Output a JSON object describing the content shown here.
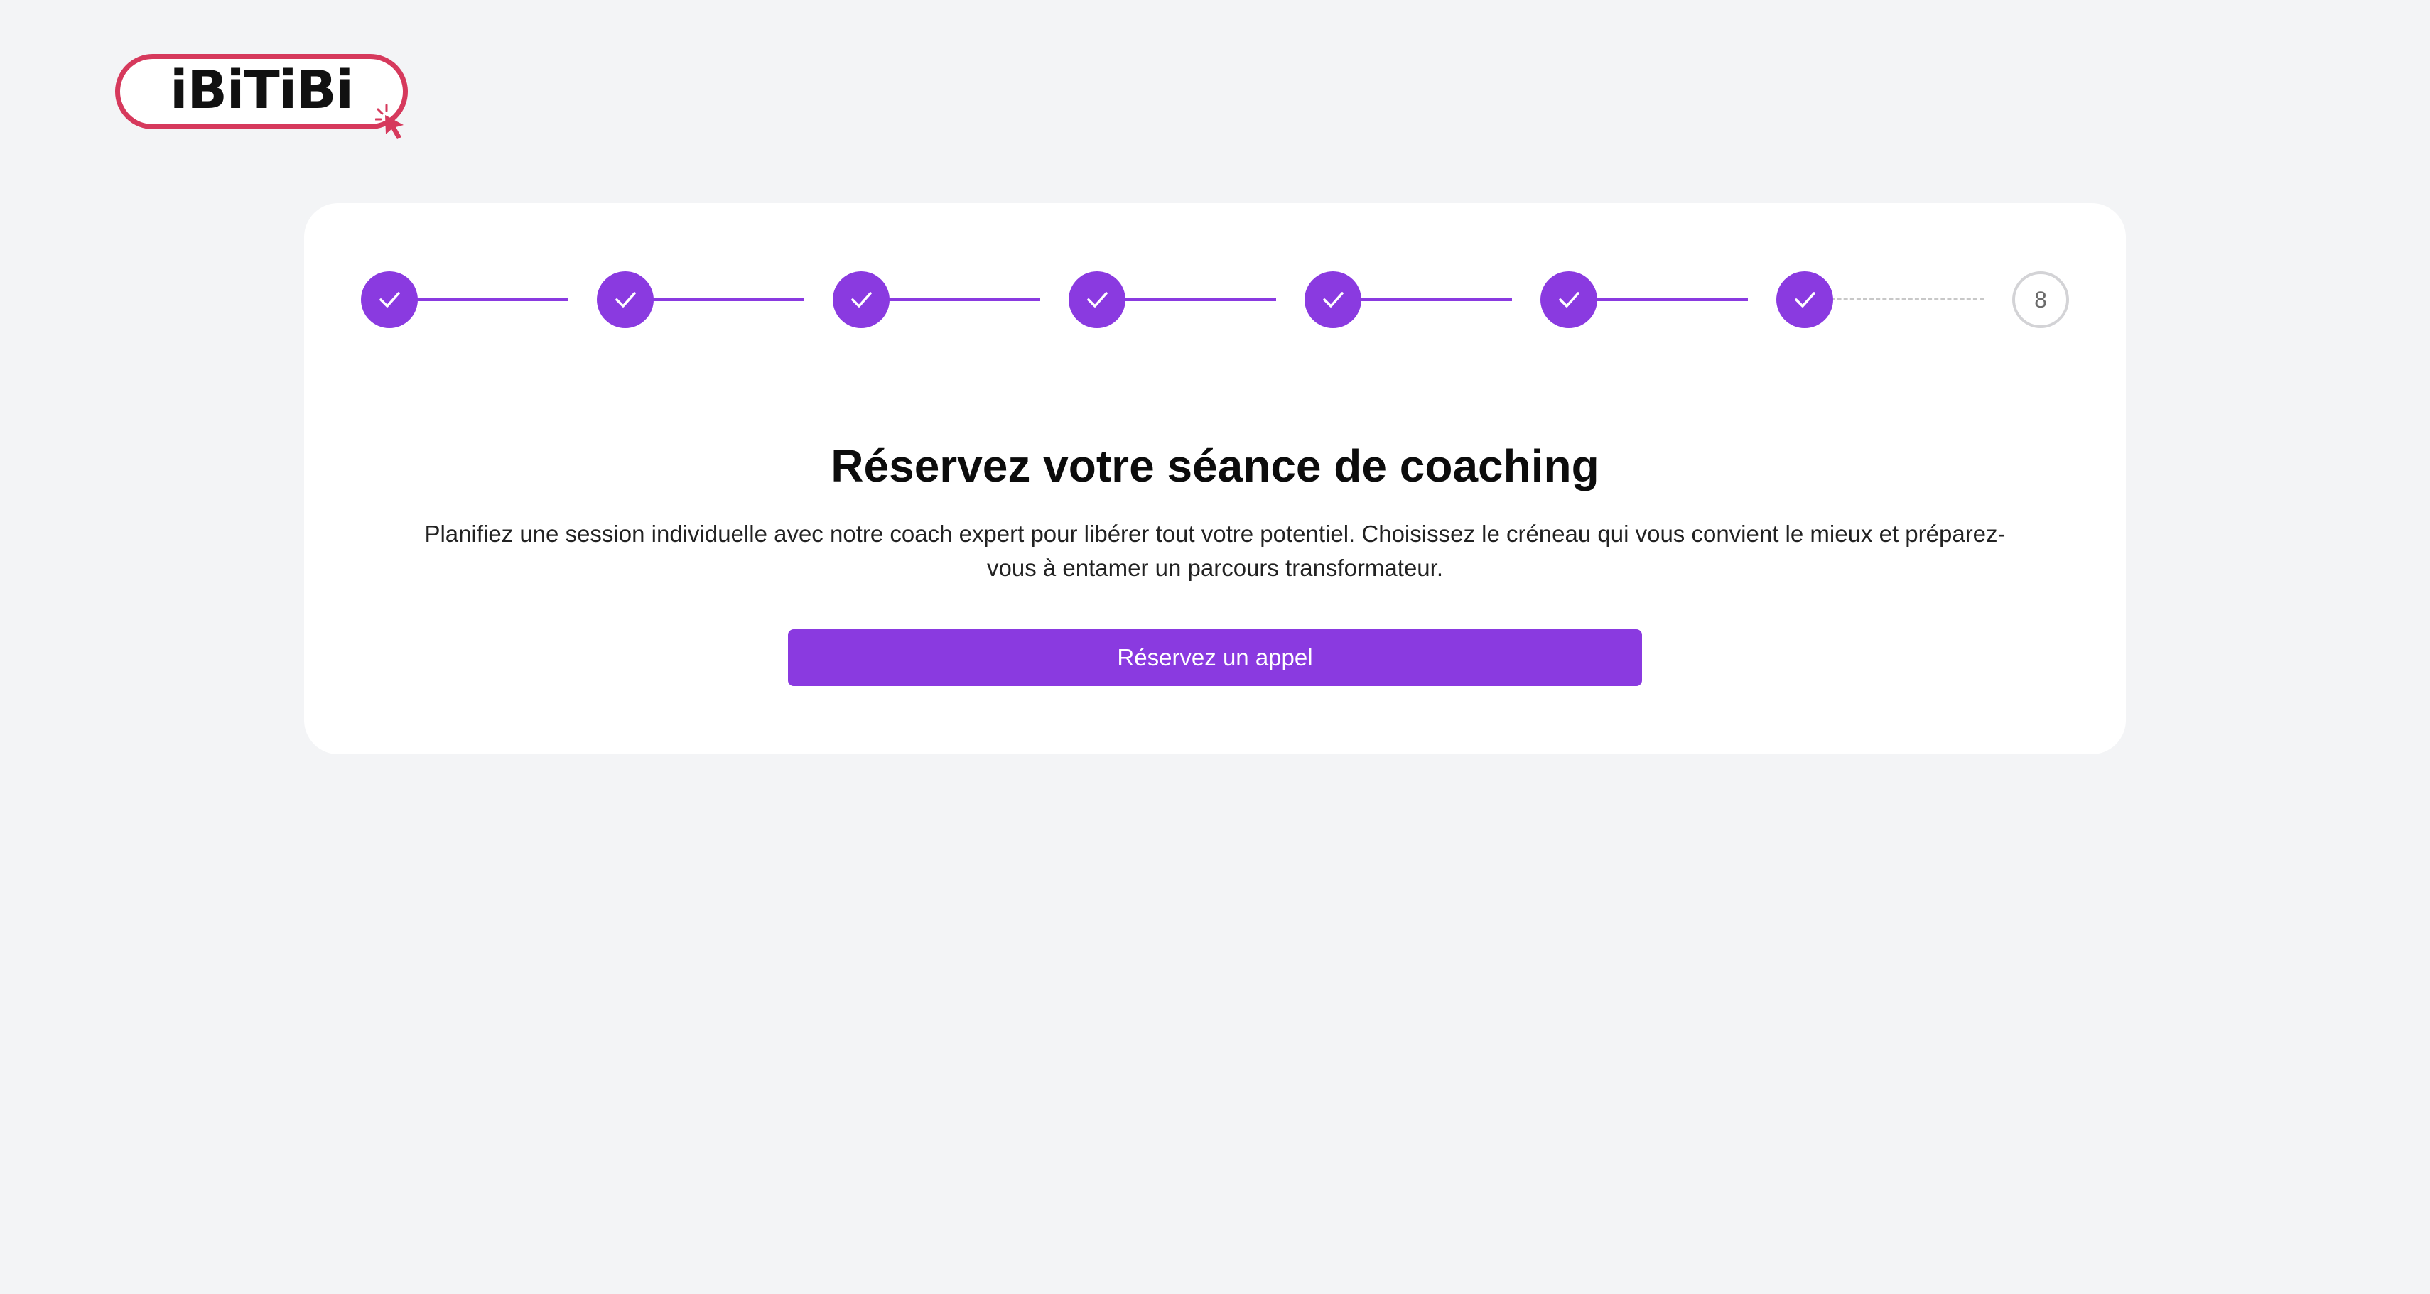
{
  "brand": {
    "logo_text": "iBiTiBi",
    "logo_color": "#d6395c"
  },
  "stepper": {
    "accent_color": "#8a3ae0",
    "steps": [
      {
        "status": "done",
        "icon": "check-icon"
      },
      {
        "status": "done",
        "icon": "check-icon"
      },
      {
        "status": "done",
        "icon": "check-icon"
      },
      {
        "status": "done",
        "icon": "check-icon"
      },
      {
        "status": "done",
        "icon": "check-icon"
      },
      {
        "status": "done",
        "icon": "check-icon"
      },
      {
        "status": "done",
        "icon": "check-icon"
      },
      {
        "status": "current",
        "label": "8"
      }
    ]
  },
  "main": {
    "title": "Réservez votre séance de coaching",
    "description": "Planifiez une session individuelle avec notre coach expert pour libérer tout votre potentiel. Choisissez le créneau qui vous convient le mieux et préparez-vous à entamer un parcours transformateur.",
    "cta_label": "Réservez un appel"
  }
}
